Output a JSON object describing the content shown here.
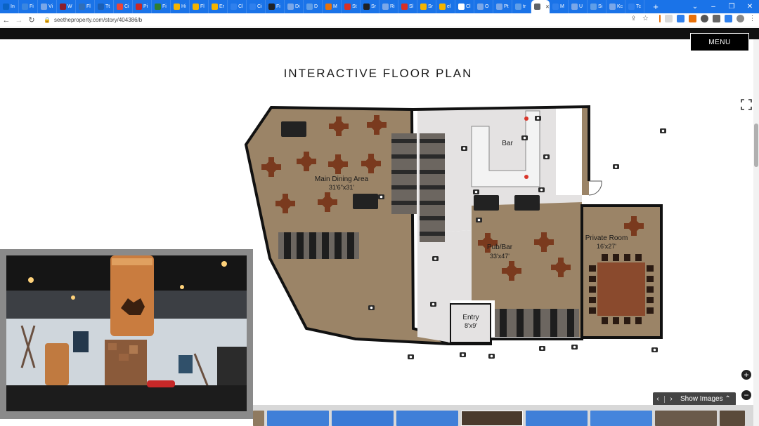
{
  "browser": {
    "tabs": [
      {
        "label": "In",
        "color": "#0b63c4"
      },
      {
        "label": "Fi",
        "color": "#3a86e0"
      },
      {
        "label": "Vi",
        "color": "#7aa7e8"
      },
      {
        "label": "W",
        "color": "#8b1e2d"
      },
      {
        "label": "Fl",
        "color": "#2f6eb8"
      },
      {
        "label": "Tt",
        "color": "#1b5fb5"
      },
      {
        "label": "Ci",
        "color": "#e8463a"
      },
      {
        "label": "Pi",
        "color": "#c62828"
      },
      {
        "label": "Fi",
        "color": "#2e7d32"
      },
      {
        "label": "Hi",
        "color": "#f4b400"
      },
      {
        "label": "Fl",
        "color": "#f4b400"
      },
      {
        "label": "Er",
        "color": "#f4b400"
      },
      {
        "label": "Cl",
        "color": "#2f80ed"
      },
      {
        "label": "Ci",
        "color": "#2f80ed"
      },
      {
        "label": "Fi",
        "color": "#202124"
      },
      {
        "label": "Di",
        "color": "#7aa7e8"
      },
      {
        "label": "D",
        "color": "#5f9ee8"
      },
      {
        "label": "M",
        "color": "#e8710a"
      },
      {
        "label": "St",
        "color": "#d93025"
      },
      {
        "label": "Sr",
        "color": "#202124"
      },
      {
        "label": "Ri",
        "color": "#7aa7e8"
      },
      {
        "label": "Sl",
        "color": "#d93025"
      },
      {
        "label": "Sr",
        "color": "#f4b400"
      },
      {
        "label": "el",
        "color": "#f4b400"
      },
      {
        "label": "Cl",
        "color": "#ffffff"
      },
      {
        "label": "O",
        "color": "#7aa7e8"
      },
      {
        "label": "Pt",
        "color": "#7aa7e8"
      },
      {
        "label": "tr",
        "color": "#5f9ee8"
      }
    ],
    "active_tab_index": 28,
    "active_tab_label": "",
    "new_tab_symbol": "+",
    "url": "seetheproperty.com/story/404386/b",
    "tabs_after": [
      {
        "label": "M",
        "color": "#2f80ed"
      },
      {
        "label": "U",
        "color": "#7aa7e8"
      },
      {
        "label": "Si",
        "color": "#5f9ee8"
      },
      {
        "label": "Kc",
        "color": "#7aa7e8"
      },
      {
        "label": "Tc",
        "color": "#2f80ed"
      }
    ]
  },
  "page": {
    "menu_label": "MENU",
    "title": "INTERACTIVE FLOOR PLAN",
    "rooms": [
      {
        "name": "Main Dining Area",
        "dims": "31'6\"x31'"
      },
      {
        "name": "Bar",
        "dims": ""
      },
      {
        "name": "Pub/Bar",
        "dims": "33'x47'"
      },
      {
        "name": "Private Room",
        "dims": "16'x27'"
      },
      {
        "name": "Entry",
        "dims": "8'x9'"
      }
    ],
    "show_images_label": "Show Images",
    "zoom_in": "+",
    "zoom_out": "−",
    "prev_arrow": "‹",
    "next_arrow": "›",
    "caret": "^",
    "colors": {
      "floor_brown": "#9b8467",
      "floor_grey": "#e4e2e2",
      "wall": "#111111",
      "table_dark": "#222222",
      "table_brown": "#7a3a1e",
      "booth": "#6c6660",
      "private_table": "#8a4a2d",
      "hotspot_red": "#d9362b"
    }
  }
}
